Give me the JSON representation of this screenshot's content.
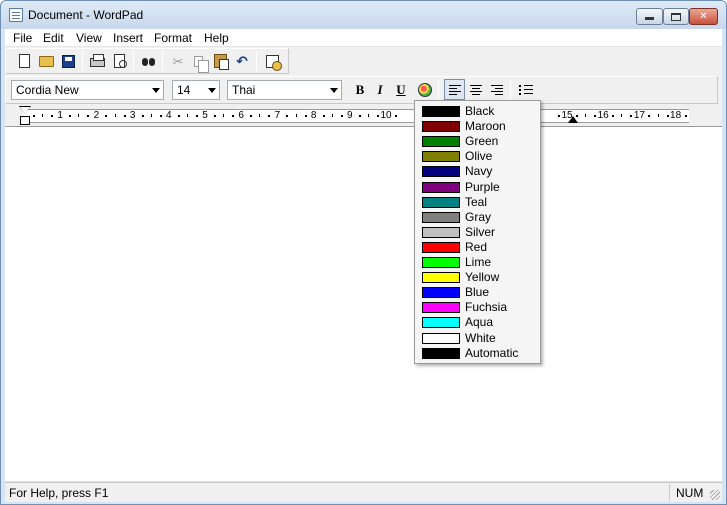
{
  "window": {
    "title": "Document - WordPad"
  },
  "menu": [
    "File",
    "Edit",
    "View",
    "Insert",
    "Format",
    "Help"
  ],
  "toolbar": {
    "icons": [
      "new-icon",
      "open-icon",
      "save-icon",
      "print-icon",
      "print-preview-icon",
      "find-icon",
      "cut-icon",
      "copy-icon",
      "paste-icon",
      "undo-icon",
      "date-time-icon"
    ]
  },
  "format_bar": {
    "font": "Cordia New",
    "size": "14",
    "script": "Thai",
    "bold": "B",
    "italic": "I",
    "underline": "U"
  },
  "ruler": {
    "labels": [
      "1",
      "2",
      "3",
      "4",
      "5",
      "6",
      "7",
      "8",
      "9",
      "10",
      "15",
      "16",
      "17",
      "18"
    ]
  },
  "color_menu": [
    {
      "name": "Black",
      "color": "#000000"
    },
    {
      "name": "Maroon",
      "color": "#800000"
    },
    {
      "name": "Green",
      "color": "#008000"
    },
    {
      "name": "Olive",
      "color": "#808000"
    },
    {
      "name": "Navy",
      "color": "#000080"
    },
    {
      "name": "Purple",
      "color": "#800080"
    },
    {
      "name": "Teal",
      "color": "#008080"
    },
    {
      "name": "Gray",
      "color": "#808080"
    },
    {
      "name": "Silver",
      "color": "#c0c0c0"
    },
    {
      "name": "Red",
      "color": "#ff0000"
    },
    {
      "name": "Lime",
      "color": "#00ff00"
    },
    {
      "name": "Yellow",
      "color": "#ffff00"
    },
    {
      "name": "Blue",
      "color": "#0000ff"
    },
    {
      "name": "Fuchsia",
      "color": "#ff00ff"
    },
    {
      "name": "Aqua",
      "color": "#00ffff"
    },
    {
      "name": "White",
      "color": "#ffffff"
    },
    {
      "name": "Automatic",
      "color": "#000000"
    }
  ],
  "status": {
    "help": "For Help, press F1",
    "num": "NUM"
  }
}
